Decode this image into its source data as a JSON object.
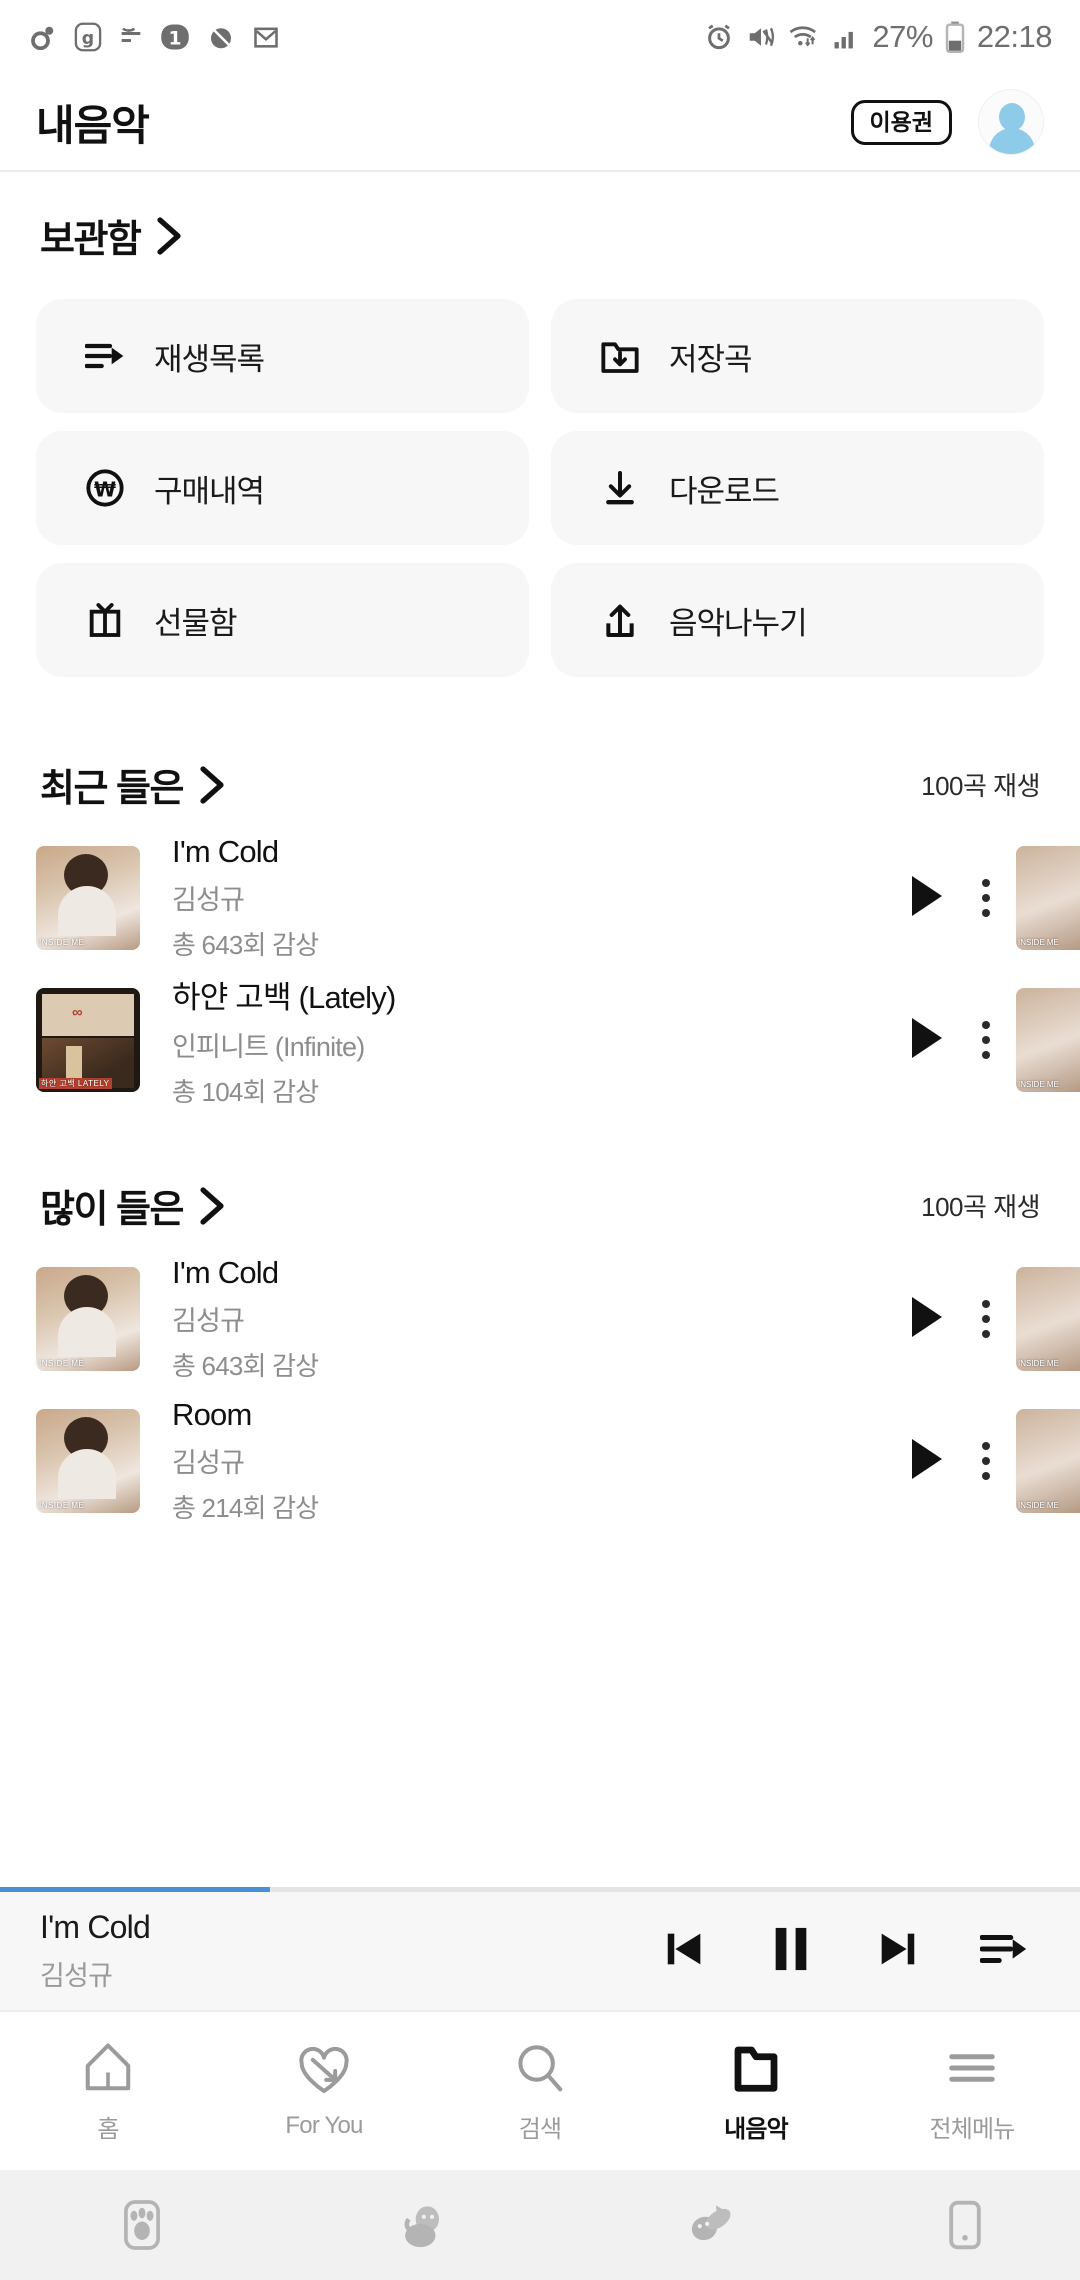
{
  "status_bar": {
    "left_icons": [
      "location-icon",
      "g-badge-icon",
      "sound-icon",
      "one-badge-icon",
      "app-icon",
      "mail-icon"
    ],
    "right_icons": [
      "alarm-icon",
      "mute-vibrate-icon",
      "wifi-icon",
      "signal-icon"
    ],
    "battery_percent": "27%",
    "time": "22:18"
  },
  "header": {
    "title": "내음악",
    "ticket_label": "이용권",
    "avatar_name": "user-avatar"
  },
  "library": {
    "section_title": "보관함",
    "items": [
      {
        "label": "재생목록",
        "icon": "playlist-icon"
      },
      {
        "label": "저장곡",
        "icon": "folder-download-icon"
      },
      {
        "label": "구매내역",
        "icon": "won-circle-icon"
      },
      {
        "label": "다운로드",
        "icon": "download-icon"
      },
      {
        "label": "선물함",
        "icon": "gift-icon"
      },
      {
        "label": "음악나누기",
        "icon": "share-icon"
      }
    ]
  },
  "recent": {
    "section_title": "최근 들은",
    "play_all": "100곡 재생",
    "songs": [
      {
        "title": "I'm Cold",
        "artist": "김성규",
        "count": "총 643회 감상",
        "cover_caption": "INSIDE ME",
        "cover_colors": [
          "#c9a88a",
          "#e8ddd5",
          "#8e6b52"
        ]
      },
      {
        "title": "하얀 고백 (Lately)",
        "artist": "인피니트 (Infinite)",
        "count": "총 104회 감상",
        "cover_caption": "하얀 고백 LATELY",
        "cover_colors": [
          "#2a2019",
          "#d9c6ac",
          "#b5412f"
        ]
      }
    ]
  },
  "most_played": {
    "section_title": "많이 들은",
    "play_all": "100곡 재생",
    "songs": [
      {
        "title": "I'm Cold",
        "artist": "김성규",
        "count": "총 643회 감상",
        "cover_caption": "INSIDE ME",
        "cover_colors": [
          "#c9a88a",
          "#e8ddd5",
          "#8e6b52"
        ]
      },
      {
        "title": "Room",
        "artist": "김성규",
        "count": "총 214회 감상",
        "cover_caption": "INSIDE ME",
        "cover_colors": [
          "#c9a88a",
          "#e8ddd5",
          "#8e6b52"
        ]
      }
    ]
  },
  "mini_player": {
    "title": "I'm Cold",
    "artist": "김성규",
    "progress_percent": 25,
    "progress_color": "#4a90d9",
    "controls": [
      "prev-icon",
      "pause-icon",
      "next-icon",
      "queue-icon"
    ]
  },
  "tabs": [
    {
      "label": "홈",
      "icon": "home-icon",
      "active": false
    },
    {
      "label": "For You",
      "icon": "heart-arrow-icon",
      "active": false
    },
    {
      "label": "검색",
      "icon": "search-icon",
      "active": false
    },
    {
      "label": "내음악",
      "icon": "folder-icon",
      "active": true
    },
    {
      "label": "전체메뉴",
      "icon": "hamburger-icon",
      "active": false
    }
  ],
  "android_nav": {
    "items": [
      "paw-recents-icon",
      "dog-home-icon",
      "cat-back-icon",
      "phone-icon"
    ]
  }
}
